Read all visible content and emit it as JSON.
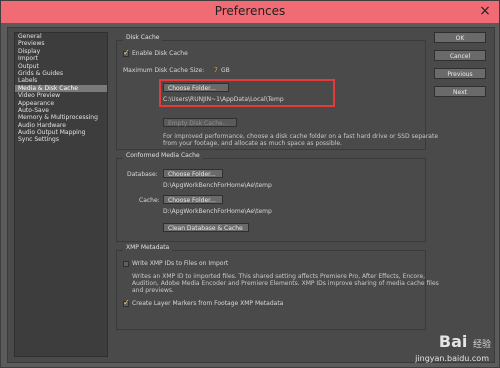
{
  "window": {
    "title": "Preferences",
    "close_glyph": "×"
  },
  "sidebar": {
    "items": [
      {
        "label": "General"
      },
      {
        "label": "Previews"
      },
      {
        "label": "Display"
      },
      {
        "label": "Import"
      },
      {
        "label": "Output"
      },
      {
        "label": "Grids & Guides"
      },
      {
        "label": "Labels"
      },
      {
        "label": "Media & Disk Cache"
      },
      {
        "label": "Video Preview"
      },
      {
        "label": "Appearance"
      },
      {
        "label": "Auto-Save"
      },
      {
        "label": "Memory & Multiprocessing"
      },
      {
        "label": "Audio Hardware"
      },
      {
        "label": "Audio Output Mapping"
      },
      {
        "label": "Sync Settings"
      }
    ],
    "selected_index": 7
  },
  "buttons": {
    "ok": "OK",
    "cancel": "Cancel",
    "previous": "Previous",
    "next": "Next"
  },
  "disk_cache": {
    "title": "Disk Cache",
    "enable_label": "Enable Disk Cache",
    "enabled": true,
    "max_size_label": "Maximum Disk Cache Size:",
    "max_size_value": "7",
    "max_size_unit": "GB",
    "choose_folder": "Choose Folder...",
    "path": "C:\\Users\\RUNJIN~1\\AppData\\Local\\Temp",
    "empty_cache": "Empty Disk Cache...",
    "help_line1": "For improved performance, choose a disk cache folder on a fast hard drive or SSD separate",
    "help_line2": "from your footage, and allocate as much space as possible."
  },
  "conformed": {
    "title": "Conformed Media Cache",
    "database_label": "Database:",
    "choose_folder_db": "Choose Folder...",
    "database_path": "D:\\ApgWorkBenchForHome\\Ae\\temp",
    "cache_label": "Cache:",
    "choose_folder_cache": "Choose Folder...",
    "cache_path": "D:\\ApgWorkBenchForHome\\Ae\\temp",
    "clean_button": "Clean Database & Cache"
  },
  "xmp": {
    "title": "XMP Metadata",
    "write_label": "Write XMP IDs to Files on Import",
    "write_checked": false,
    "write_help_1": "Writes an XMP ID to imported files. This shared setting affects Premiere Pro, After Effects, Encore,",
    "write_help_2": "Audition, Adobe Media Encoder and Premiere Elements. XMP IDs improve sharing of media cache files",
    "write_help_3": "and previews.",
    "create_markers_label": "Create Layer Markers from Footage XMP Metadata",
    "create_markers_checked": true
  },
  "watermark": {
    "brand": "Bai",
    "brand_suffix": "经验",
    "url": "jingyan.baidu.com"
  }
}
